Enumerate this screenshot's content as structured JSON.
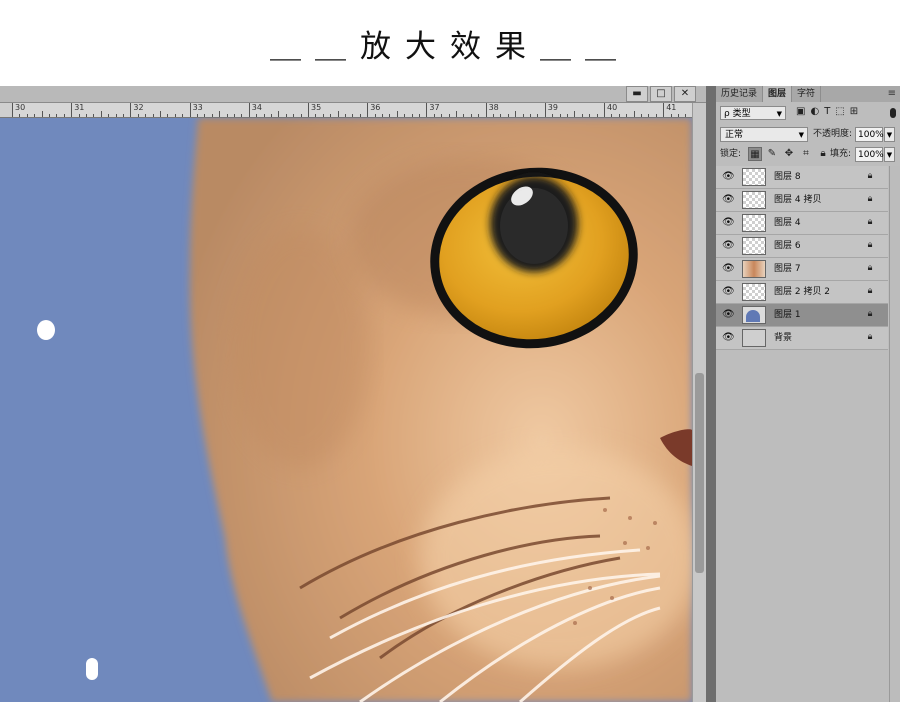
{
  "caption": "＿＿放大效果＿＿",
  "window": {
    "buttons": [
      {
        "name": "minimize-button",
        "glyph": "▬"
      },
      {
        "name": "maximize-button",
        "glyph": "□"
      },
      {
        "name": "close-button",
        "glyph": "✕"
      }
    ]
  },
  "ruler": {
    "labels": [
      "30",
      "31",
      "32",
      "33",
      "34",
      "35",
      "36",
      "37",
      "38",
      "39",
      "40",
      "41"
    ]
  },
  "panel": {
    "tabs": [
      "历史记录",
      "图层",
      "字符"
    ],
    "active_tab": "图层",
    "kind_label": "ρ 类型",
    "blend_mode": "正常",
    "opacity_label": "不透明度:",
    "opacity_value": "100%",
    "lock_label": "锁定:",
    "fill_label": "填充:",
    "fill_value": "100%"
  },
  "layers": [
    {
      "name": "图层 8",
      "thumb": "transparent",
      "locked": true,
      "selected": false
    },
    {
      "name": "图层 4 拷贝",
      "thumb": "transparent",
      "locked": true,
      "selected": false
    },
    {
      "name": "图层 4",
      "thumb": "transparent",
      "locked": true,
      "selected": false
    },
    {
      "name": "图层 6",
      "thumb": "transparent",
      "locked": true,
      "selected": false
    },
    {
      "name": "图层 7",
      "thumb": "cat",
      "locked": true,
      "selected": false
    },
    {
      "name": "图层 2 拷贝 2",
      "thumb": "transparent",
      "locked": true,
      "selected": false
    },
    {
      "name": "图层 1",
      "thumb": "blue",
      "locked": true,
      "selected": true
    },
    {
      "name": "背景",
      "thumb": "gray",
      "locked": true,
      "selected": false
    }
  ],
  "colors": {
    "canvas_background": "#7089bd",
    "cat_fur": "#c99567",
    "eye_iris": "#e4a324"
  }
}
